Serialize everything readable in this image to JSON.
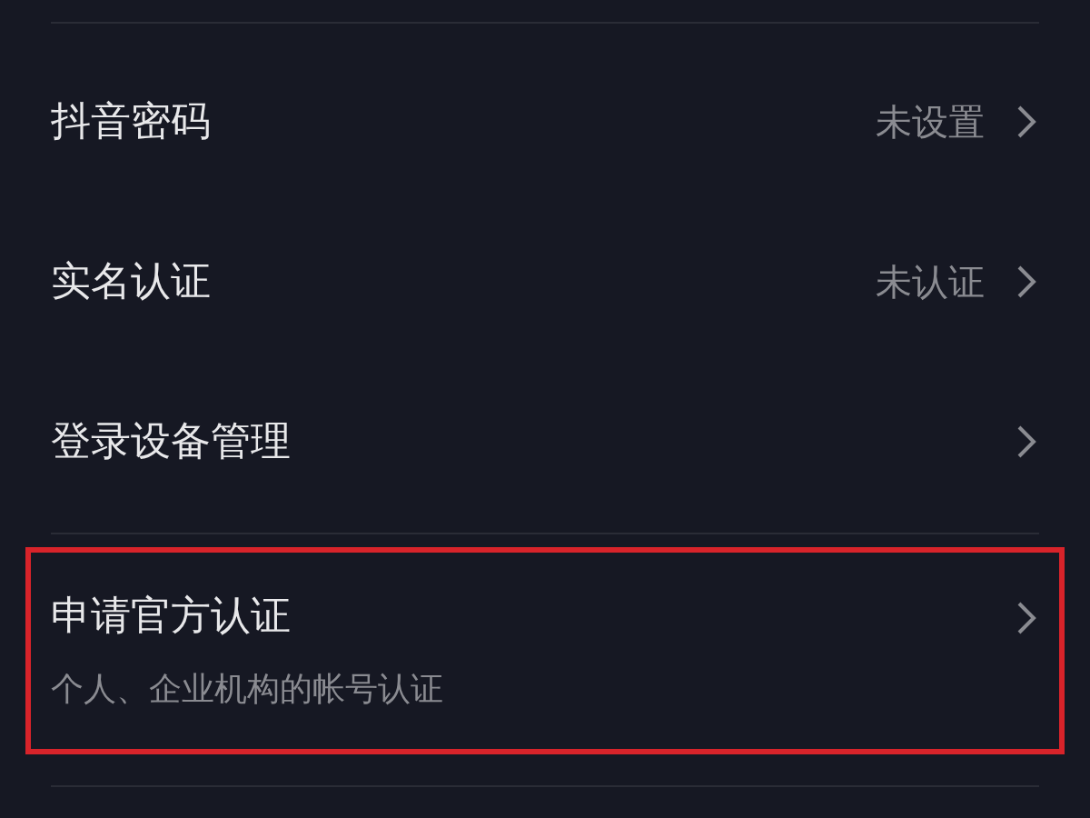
{
  "settings": [
    {
      "title": "抖音密码",
      "value": "未设置",
      "highlighted": false
    },
    {
      "title": "实名认证",
      "value": "未认证",
      "highlighted": false
    },
    {
      "title": "登录设备管理",
      "highlighted": false
    },
    {
      "title": "申请官方认证",
      "subtitle": "个人、企业机构的帐号认证",
      "highlighted": true
    }
  ]
}
